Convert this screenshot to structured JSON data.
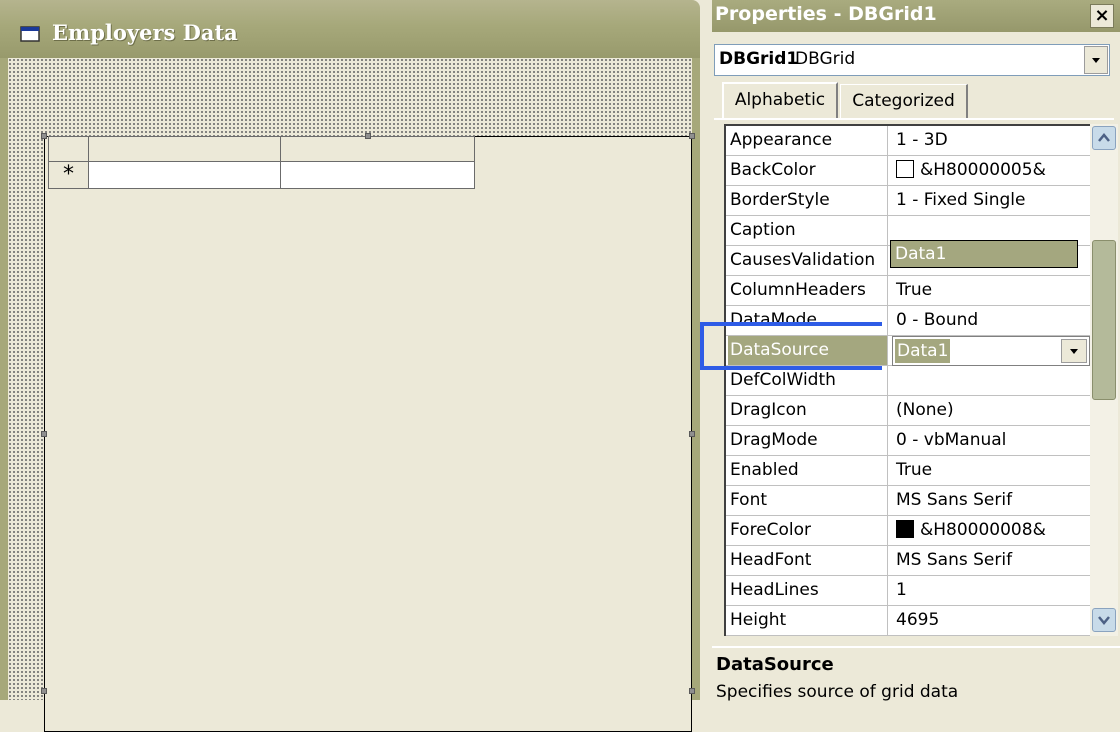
{
  "form": {
    "title": "Employers Data",
    "grid": {
      "new_row_indicator": "*"
    }
  },
  "properties": {
    "title": "Properties - DBGrid1",
    "close": "×",
    "object": {
      "name": "DBGrid1",
      "type": "DBGrid"
    },
    "tabs": [
      "Alphabetic",
      "Categorized"
    ],
    "rows": [
      {
        "name": "Appearance",
        "value": "1 - 3D"
      },
      {
        "name": "BackColor",
        "value": "&H80000005&",
        "swatch": "#ffffff"
      },
      {
        "name": "BorderStyle",
        "value": "1 - Fixed Single"
      },
      {
        "name": "Caption",
        "value": ""
      },
      {
        "name": "CausesValidation",
        "value": "True"
      },
      {
        "name": "ColumnHeaders",
        "value": "True"
      },
      {
        "name": "DataMode",
        "value": "0 - Bound"
      },
      {
        "name": "DataSource",
        "value": "Data1",
        "selected": true
      },
      {
        "name": "DefColWidth",
        "value": ""
      },
      {
        "name": "DragIcon",
        "value": "(None)"
      },
      {
        "name": "DragMode",
        "value": "0 - vbManual"
      },
      {
        "name": "Enabled",
        "value": "True"
      },
      {
        "name": "Font",
        "value": "MS Sans Serif"
      },
      {
        "name": "ForeColor",
        "value": "&H80000008&",
        "swatch": "#000000"
      },
      {
        "name": "HeadFont",
        "value": "MS Sans Serif"
      },
      {
        "name": "HeadLines",
        "value": "1"
      },
      {
        "name": "Height",
        "value": "4695"
      }
    ],
    "dropdown_option": "Data1",
    "description": {
      "title": "DataSource",
      "text": "Specifies source of grid data"
    }
  },
  "colors": {
    "titlebar": "#a6a87a",
    "selection": "#a4a77f",
    "highlight_outline": "#2e5ce6"
  }
}
